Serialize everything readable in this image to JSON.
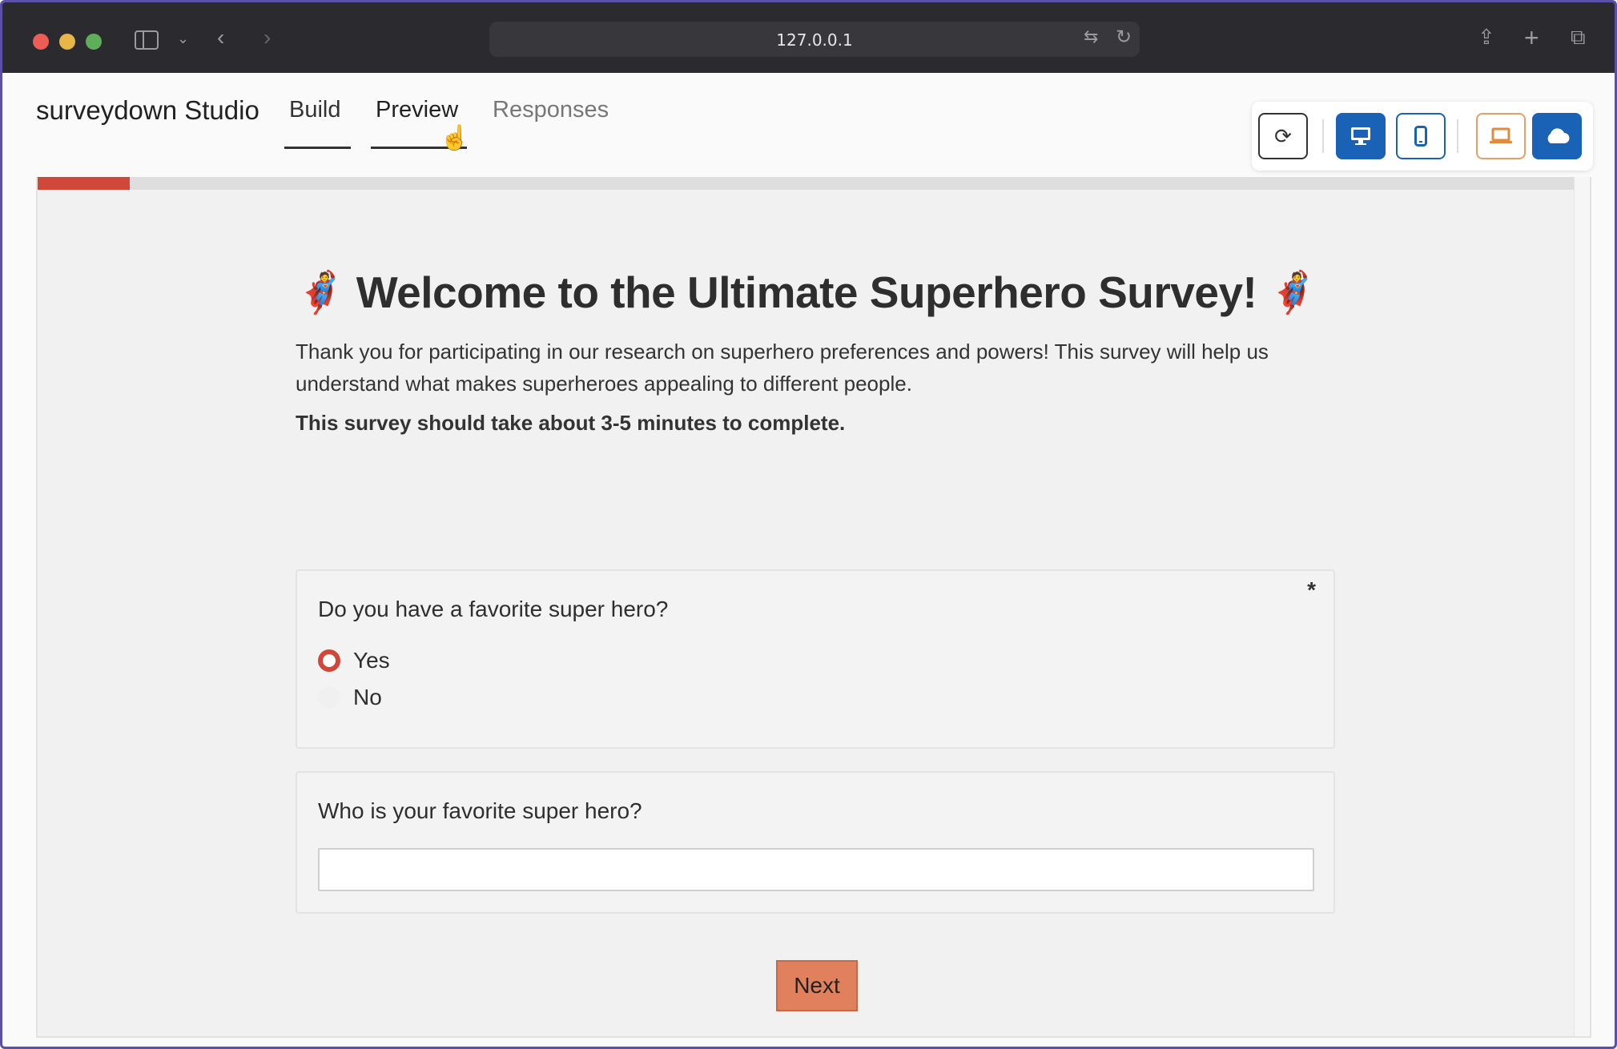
{
  "browser": {
    "url": "127.0.0.1"
  },
  "app": {
    "brand": "surveydown Studio",
    "tabs": [
      {
        "label": "Build"
      },
      {
        "label": "Preview"
      },
      {
        "label": "Responses"
      }
    ],
    "active_tab": "Preview",
    "toolbar": {
      "icons": [
        "refresh-icon",
        "desktop-icon",
        "mobile-icon",
        "laptop-icon",
        "cloud-icon"
      ]
    }
  },
  "survey": {
    "progress_percent": 6,
    "title": "Welcome to the Ultimate Superhero Survey!",
    "hero_icon_char": "🦸",
    "intro": "Thank you for participating in our research on superhero preferences and powers! This survey will help us understand what makes superheroes appealing to different people.",
    "duration": "This survey should take about 3-5 minutes to complete.",
    "questions": [
      {
        "label": "Do you have a favorite super hero?",
        "required_mark": "*",
        "options": [
          "Yes",
          "No"
        ],
        "selected": "Yes"
      },
      {
        "label": "Who is your favorite super hero?",
        "value": ""
      }
    ],
    "next_label": "Next"
  },
  "colors": {
    "accent": "#d1483a",
    "primary_blue": "#1a62b5",
    "next_button": "#e1805c",
    "chrome": "#2b2b2f"
  }
}
